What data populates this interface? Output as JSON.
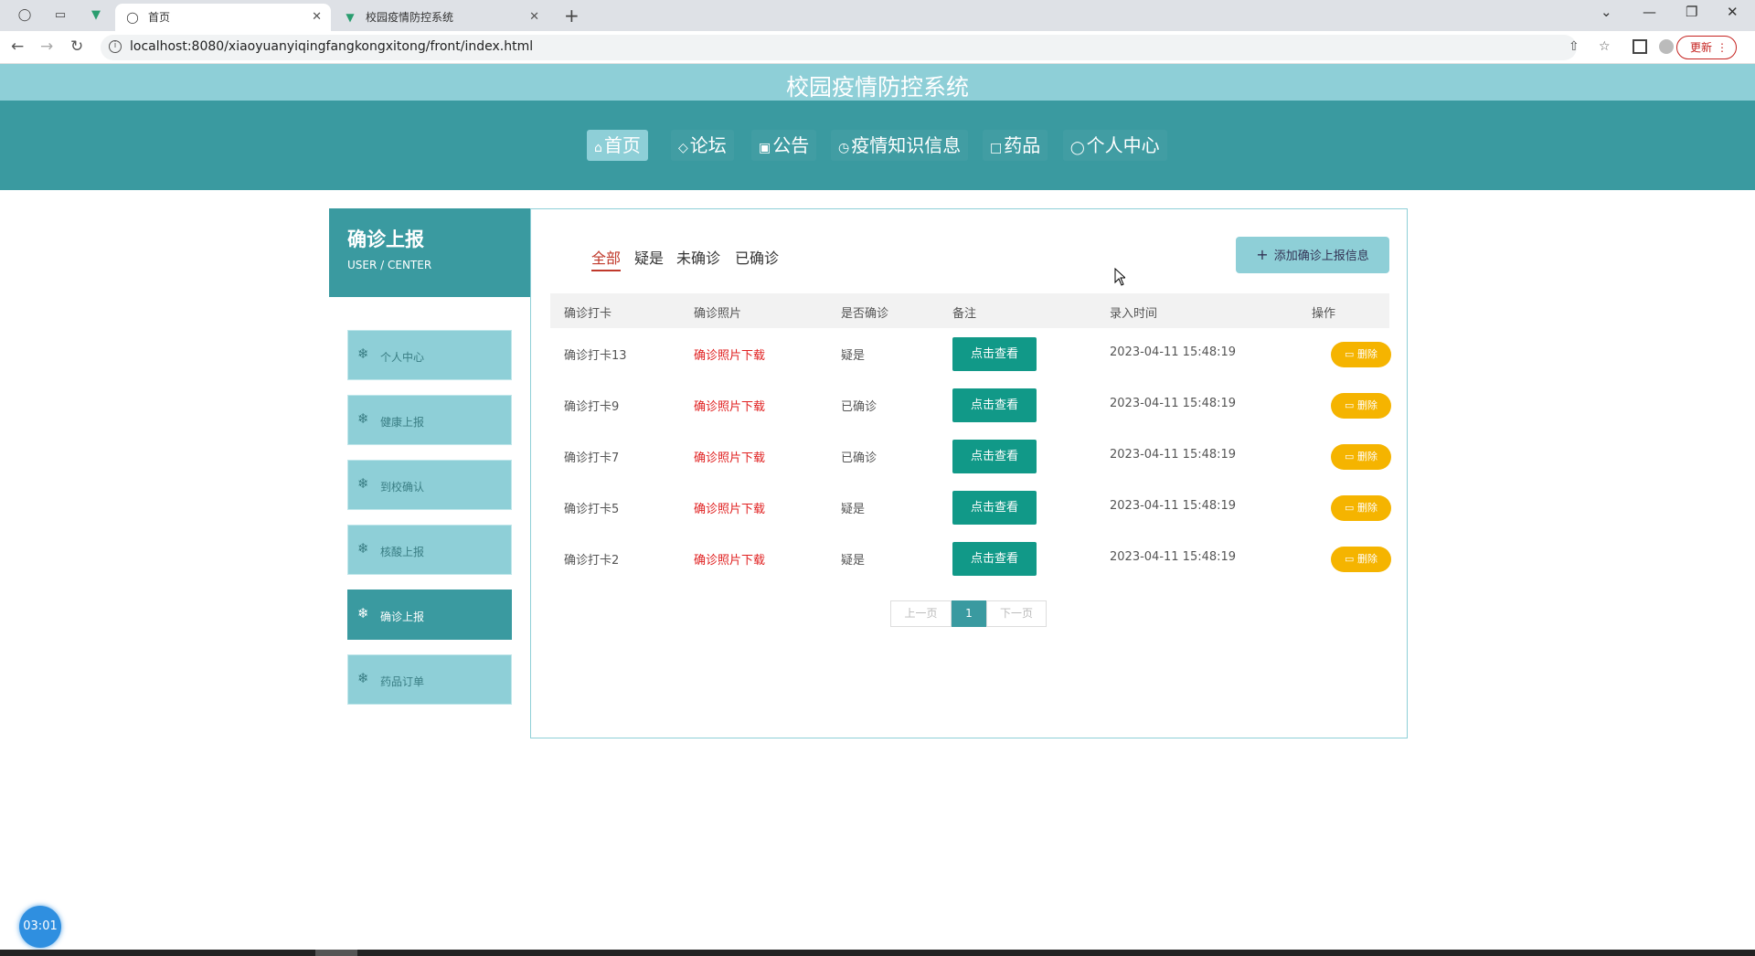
{
  "browser": {
    "tabs": [
      {
        "label": "首页",
        "active": true
      },
      {
        "label": "校园疫情防控系统",
        "active": false
      }
    ],
    "url": "localhost:8080/xiaoyuanyiqingfangkongxitong/front/index.html",
    "update_label": "更新"
  },
  "site": {
    "title": "校园疫情防控系统",
    "nav": [
      {
        "label": "首页",
        "icon": "home-icon",
        "active": true
      },
      {
        "label": "论坛",
        "icon": "tag-icon",
        "active": false
      },
      {
        "label": "公告",
        "icon": "gift-icon",
        "active": false
      },
      {
        "label": "疫情知识信息",
        "icon": "clock-icon",
        "active": false
      },
      {
        "label": "药品",
        "icon": "document-icon",
        "active": false
      },
      {
        "label": "个人中心",
        "icon": "user-icon",
        "active": false
      }
    ]
  },
  "sidebar": {
    "title": "确诊上报",
    "subtitle": "USER / CENTER",
    "items": [
      {
        "label": "个人中心",
        "active": false
      },
      {
        "label": "健康上报",
        "active": false
      },
      {
        "label": "到校确认",
        "active": false
      },
      {
        "label": "核酸上报",
        "active": false
      },
      {
        "label": "确诊上报",
        "active": true
      },
      {
        "label": "药品订单",
        "active": false
      }
    ]
  },
  "main": {
    "filters": [
      "全部",
      "疑是",
      "未确诊",
      "已确诊"
    ],
    "active_filter": "全部",
    "add_button": "添加确诊上报信息",
    "columns": [
      "确诊打卡",
      "确诊照片",
      "是否确诊",
      "备注",
      "录入时间",
      "操作"
    ],
    "rows": [
      {
        "name": "确诊打卡13",
        "photo": "确诊照片下载",
        "status": "疑是",
        "view": "点击查看",
        "time": "2023-04-11 15:48:19",
        "delete": "删除"
      },
      {
        "name": "确诊打卡9",
        "photo": "确诊照片下载",
        "status": "已确诊",
        "view": "点击查看",
        "time": "2023-04-11 15:48:19",
        "delete": "删除"
      },
      {
        "name": "确诊打卡7",
        "photo": "确诊照片下载",
        "status": "已确诊",
        "view": "点击查看",
        "time": "2023-04-11 15:48:19",
        "delete": "删除"
      },
      {
        "name": "确诊打卡5",
        "photo": "确诊照片下载",
        "status": "疑是",
        "view": "点击查看",
        "time": "2023-04-11 15:48:19",
        "delete": "删除"
      },
      {
        "name": "确诊打卡2",
        "photo": "确诊照片下载",
        "status": "疑是",
        "view": "点击查看",
        "time": "2023-04-11 15:48:19",
        "delete": "删除"
      }
    ],
    "pagination": {
      "prev": "上一页",
      "current": "1",
      "next": "下一页"
    }
  },
  "overlay": {
    "timer": "03:01"
  },
  "colors": {
    "accent": "#3a9aa0",
    "accent_light": "#8ecfd7",
    "view_button": "#119988",
    "delete_button": "#f5b400",
    "link_red": "#e02020"
  }
}
